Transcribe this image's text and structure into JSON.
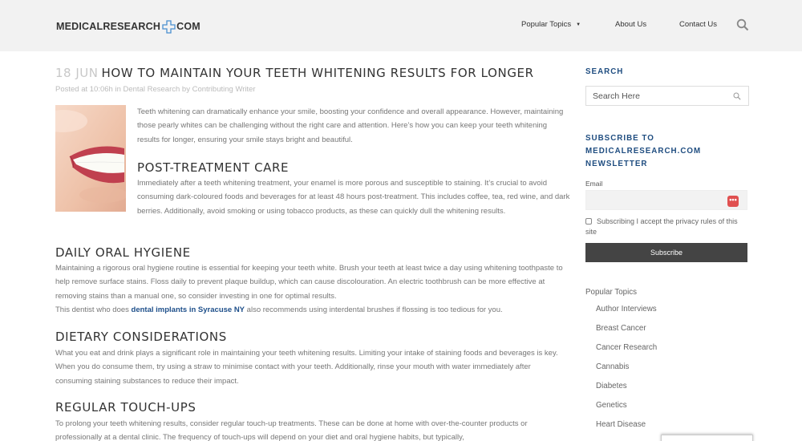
{
  "header": {
    "logo_left": "MEDICALRESEARCH",
    "logo_right": "COM",
    "nav": {
      "popular_topics": "Popular Topics",
      "about_us": "About Us",
      "contact_us": "Contact Us"
    }
  },
  "article": {
    "date": "18 JUN",
    "title": "HOW TO MAINTAIN YOUR TEETH WHITENING RESULTS FOR LONGER",
    "meta": "Posted at 10:06h in Dental Research by Contributing Writer",
    "intro": "Teeth whitening can dramatically enhance your smile, boosting your confidence and overall appearance. However, maintaining those pearly whites can be challenging without the right care and attention. Here’s how you can keep your teeth whitening results for longer, ensuring your smile stays bright and beautiful.",
    "sections": [
      {
        "heading": "POST-TREATMENT CARE",
        "body": "Immediately after a teeth whitening treatment, your enamel is more porous and susceptible to staining. It’s crucial to avoid consuming dark-coloured foods and beverages for at least 48 hours post-treatment. This includes coffee, tea, red wine, and dark berries. Additionally, avoid smoking or using tobacco products, as these can quickly dull the whitening results."
      },
      {
        "heading": "DAILY ORAL HYGIENE",
        "body": "Maintaining a rigorous oral hygiene routine is essential for keeping your teeth white. Brush your teeth at least twice a day using whitening toothpaste to help remove surface stains. Floss daily to prevent plaque buildup, which can cause discolouration. An electric toothbrush can be more effective at removing stains than a manual one, so consider investing in one for optimal results.",
        "extra_before": "This dentist who does ",
        "extra_link": "dental implants in Syracuse NY",
        "extra_after": " also recommends using interdental brushes if flossing is too tedious for you."
      },
      {
        "heading": "DIETARY CONSIDERATIONS",
        "body": "What you eat and drink plays a significant role in maintaining your teeth whitening results. Limiting your intake of staining foods and beverages is key. When you do consume them, try using a straw to minimise contact with your teeth. Additionally, rinse your mouth with water immediately after consuming staining substances to reduce their impact."
      },
      {
        "heading": "REGULAR TOUCH-UPS",
        "body": "To prolong your teeth whitening results, consider regular touch-up treatments. These can be done at home with over-the-counter products or professionally at a dental clinic. The frequency of touch-ups will depend on your diet and oral hygiene habits, but typically,"
      }
    ]
  },
  "sidebar": {
    "search_heading": "SEARCH",
    "search_placeholder": "Search Here",
    "subscribe_heading": "SUBSCRIBE TO MEDICALRESEARCH.COM NEWSLETTER",
    "email_label": "Email",
    "email_badge": "•••",
    "consent": "Subscribing I accept the privacy rules of this site",
    "subscribe_button": "Subscribe",
    "popular_topics_heading": "Popular Topics",
    "topics": [
      "Author Interviews",
      "Breast Cancer",
      "Cancer Research",
      "Cannabis",
      "Diabetes",
      "Genetics",
      "Heart Disease"
    ]
  },
  "colors": {
    "link": "#1e4f8a",
    "sidebar_heading": "#1f4d80",
    "header_bg": "#f2f2f2",
    "logo_cross": "#4a8fd0"
  }
}
